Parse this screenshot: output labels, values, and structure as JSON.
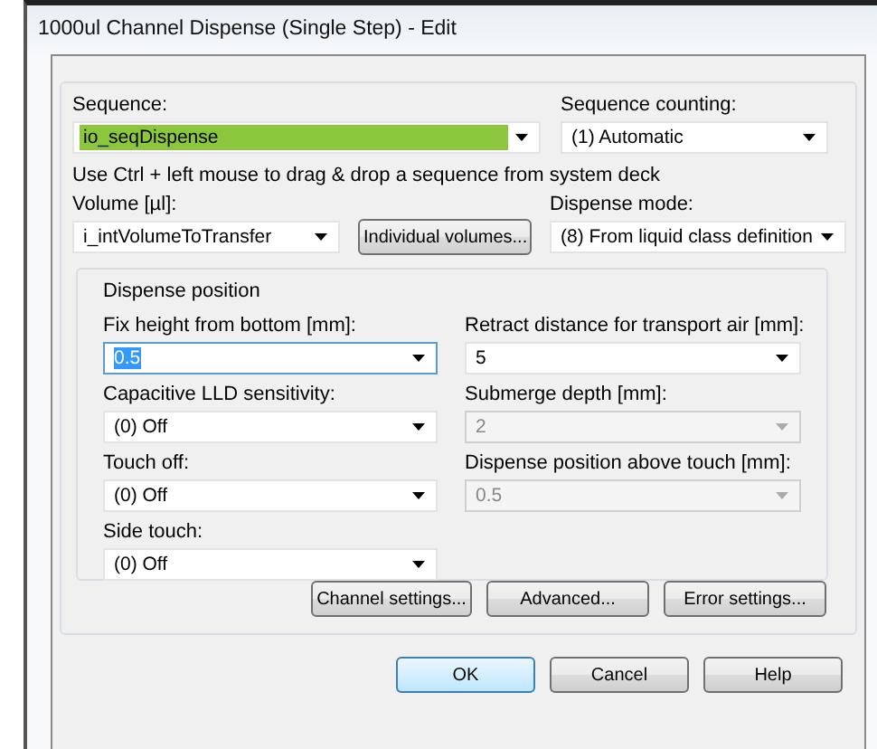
{
  "window": {
    "title": "1000ul Channel Dispense (Single Step) - Edit"
  },
  "sequence": {
    "label": "Sequence:",
    "value": "io_seqDispense",
    "text_selected": true
  },
  "sequence_counting": {
    "label": "Sequence counting:",
    "value": "(1) Automatic"
  },
  "hint": "Use Ctrl + left mouse to drag & drop a sequence from system deck",
  "volume": {
    "label": "Volume [µl]:",
    "value": "i_intVolumeToTransfer"
  },
  "individual_volumes_button": "Individual volumes...",
  "dispense_mode": {
    "label": "Dispense mode:",
    "value": "(8) From liquid class definition"
  },
  "dispense_position": {
    "title": "Dispense position",
    "fields": [
      {
        "label": "Fix height from bottom [mm]:",
        "value": "0.5",
        "disabled": false,
        "focused": true
      },
      {
        "label": "Retract distance for transport air [mm]:",
        "value": "5",
        "disabled": false,
        "focused": false
      },
      {
        "label": "Capacitive LLD sensitivity:",
        "value": "(0) Off",
        "disabled": false,
        "focused": false
      },
      {
        "label": "Submerge depth [mm]:",
        "value": "2",
        "disabled": true,
        "focused": false
      },
      {
        "label": "Touch off:",
        "value": "(0) Off",
        "disabled": false,
        "focused": false
      },
      {
        "label": "Dispense position above touch [mm]:",
        "value": "0.5",
        "disabled": true,
        "focused": false
      },
      {
        "label": "Side touch:",
        "value": "(0) Off",
        "disabled": false,
        "focused": false
      }
    ]
  },
  "settings_buttons": [
    "Channel settings...",
    "Advanced...",
    "Error settings..."
  ],
  "dialog_buttons": [
    {
      "label": "OK",
      "default": true
    },
    {
      "label": "Cancel",
      "default": false
    },
    {
      "label": "Help",
      "default": false
    }
  ]
}
